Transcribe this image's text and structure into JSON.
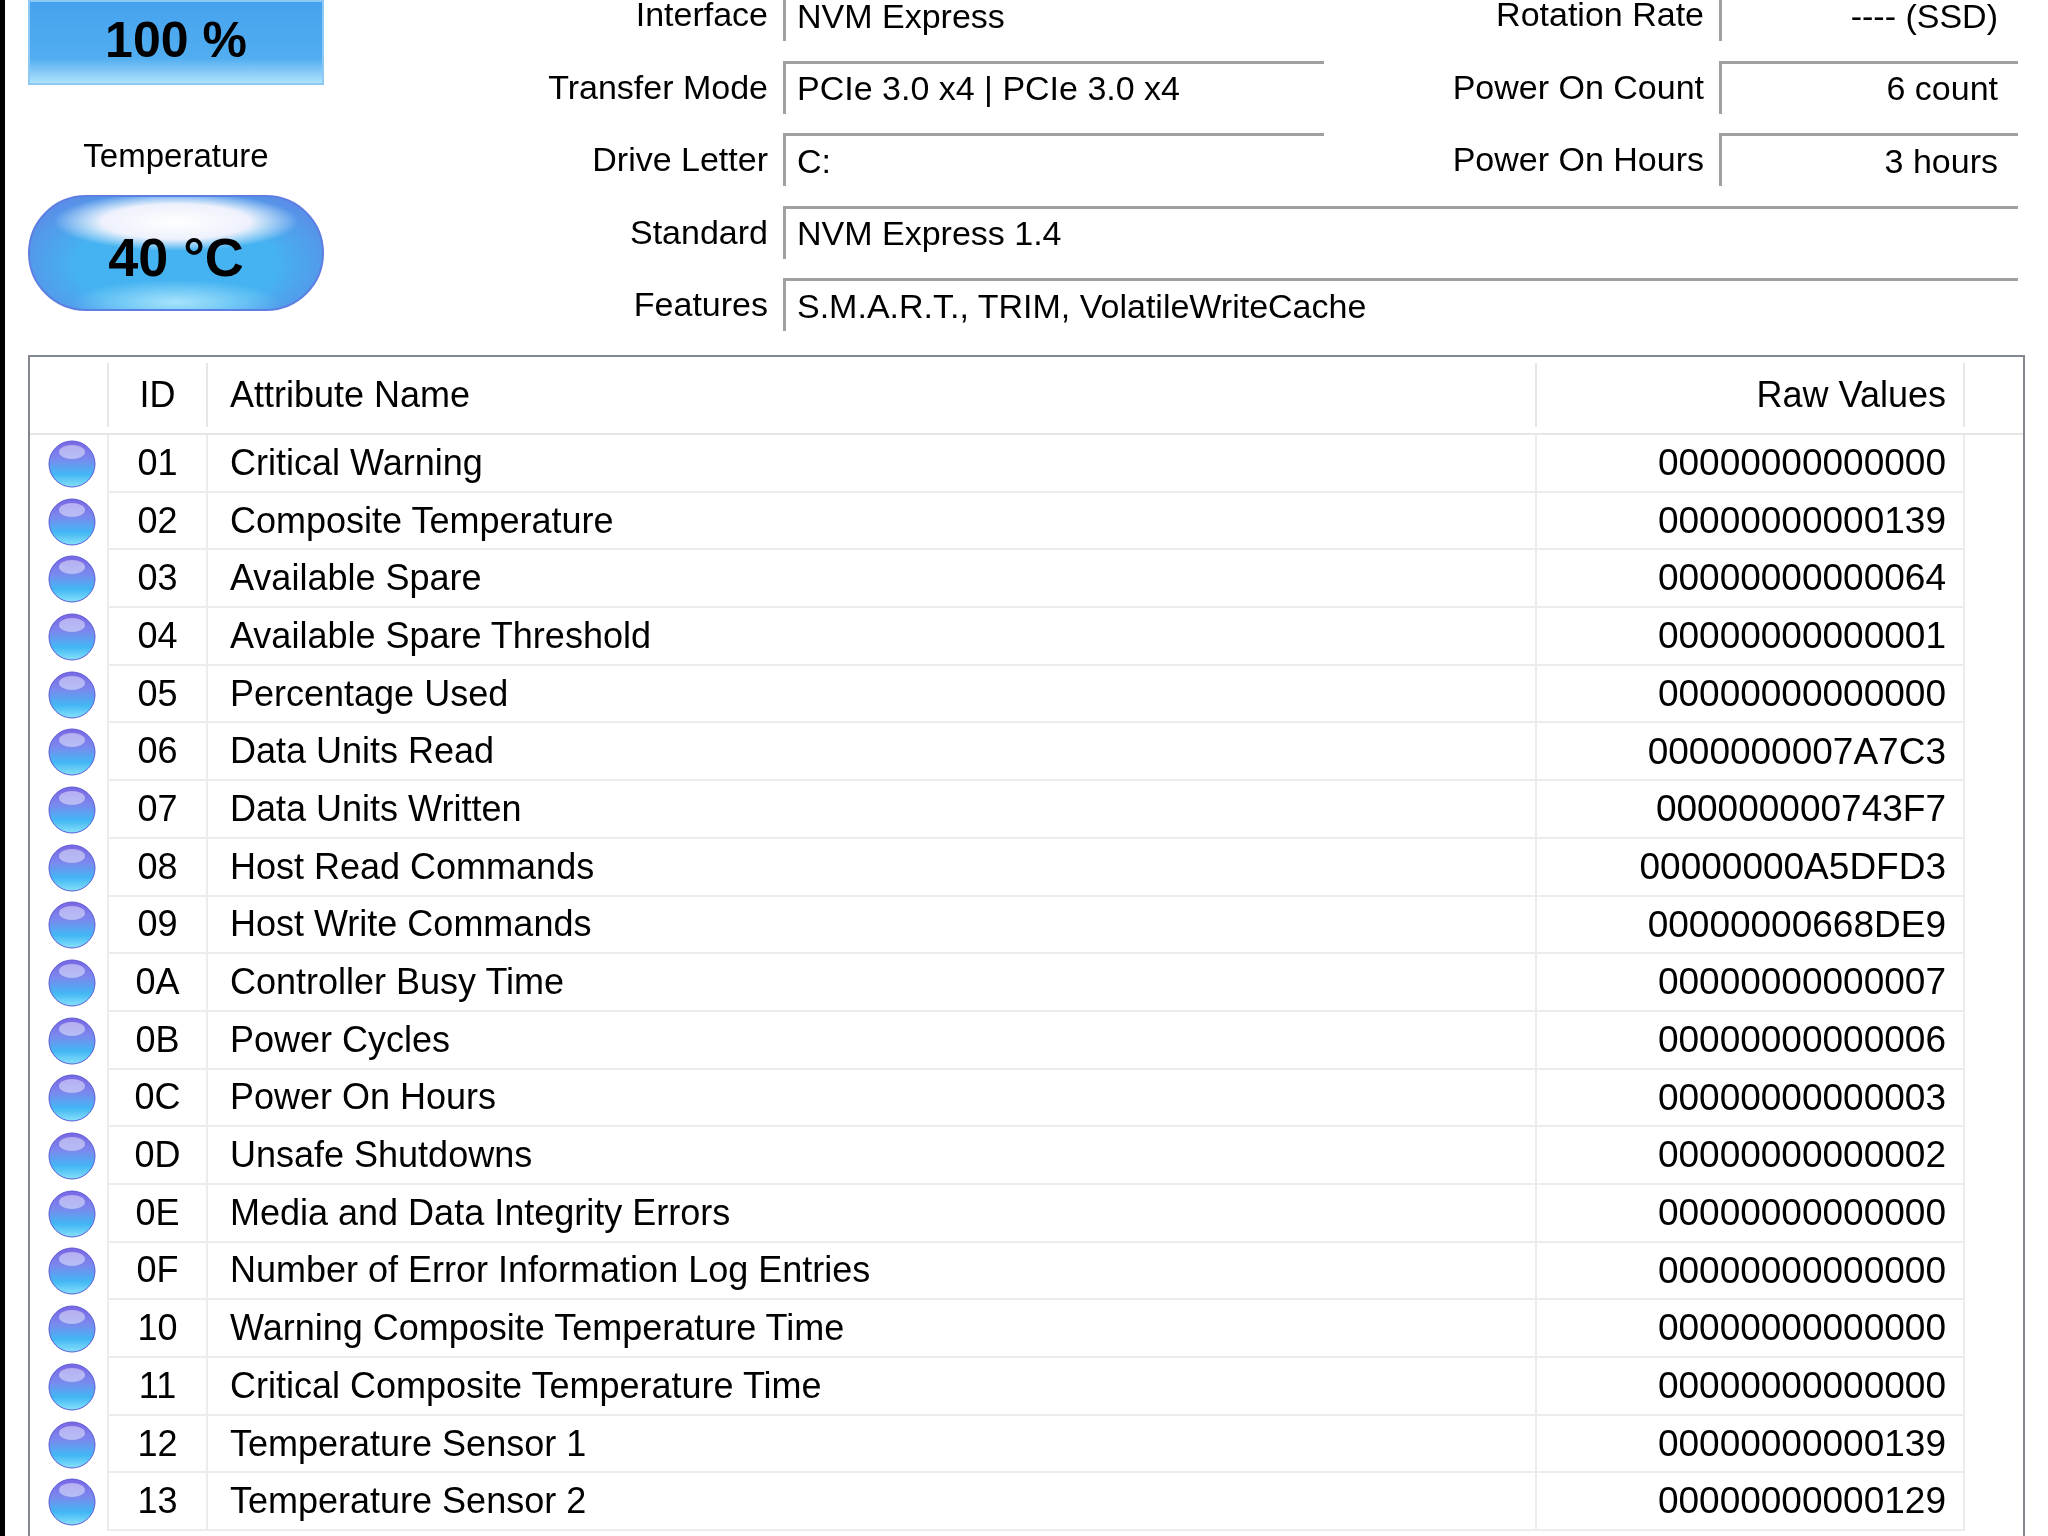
{
  "health": {
    "value": "100 %"
  },
  "temperature": {
    "label": "Temperature",
    "value": "40 °C"
  },
  "drive_info": [
    {
      "label": "Interface",
      "value": "NVM Express",
      "right": {
        "label": "Rotation Rate",
        "value": "---- (SSD)"
      }
    },
    {
      "label": "Transfer Mode",
      "value": "PCIe 3.0 x4 | PCIe 3.0 x4",
      "right": {
        "label": "Power On Count",
        "value": "6 count"
      }
    },
    {
      "label": "Drive Letter",
      "value": "C:",
      "right": {
        "label": "Power On Hours",
        "value": "3 hours"
      }
    },
    {
      "label": "Standard",
      "value": "NVM Express 1.4"
    },
    {
      "label": "Features",
      "value": "S.M.A.R.T., TRIM, VolatileWriteCache"
    }
  ],
  "smart_table": {
    "columns": [
      "ID",
      "Attribute Name",
      "Raw Values"
    ],
    "rows": [
      {
        "id": "01",
        "name": "Critical Warning",
        "raw": "00000000000000"
      },
      {
        "id": "02",
        "name": "Composite Temperature",
        "raw": "00000000000139"
      },
      {
        "id": "03",
        "name": "Available Spare",
        "raw": "00000000000064"
      },
      {
        "id": "04",
        "name": "Available Spare Threshold",
        "raw": "00000000000001"
      },
      {
        "id": "05",
        "name": "Percentage Used",
        "raw": "00000000000000"
      },
      {
        "id": "06",
        "name": "Data Units Read",
        "raw": "0000000007A7C3"
      },
      {
        "id": "07",
        "name": "Data Units Written",
        "raw": "000000000743F7"
      },
      {
        "id": "08",
        "name": "Host Read Commands",
        "raw": "00000000A5DFD3"
      },
      {
        "id": "09",
        "name": "Host Write Commands",
        "raw": "00000000668DE9"
      },
      {
        "id": "0A",
        "name": "Controller Busy Time",
        "raw": "00000000000007"
      },
      {
        "id": "0B",
        "name": "Power Cycles",
        "raw": "00000000000006"
      },
      {
        "id": "0C",
        "name": "Power On Hours",
        "raw": "00000000000003"
      },
      {
        "id": "0D",
        "name": "Unsafe Shutdowns",
        "raw": "00000000000002"
      },
      {
        "id": "0E",
        "name": "Media and Data Integrity Errors",
        "raw": "00000000000000"
      },
      {
        "id": "0F",
        "name": "Number of Error Information Log Entries",
        "raw": "00000000000000"
      },
      {
        "id": "10",
        "name": "Warning Composite Temperature Time",
        "raw": "00000000000000"
      },
      {
        "id": "11",
        "name": "Critical Composite Temperature Time",
        "raw": "00000000000000"
      },
      {
        "id": "12",
        "name": "Temperature Sensor 1",
        "raw": "00000000000139"
      },
      {
        "id": "13",
        "name": "Temperature Sensor 2",
        "raw": "00000000000129"
      }
    ]
  }
}
